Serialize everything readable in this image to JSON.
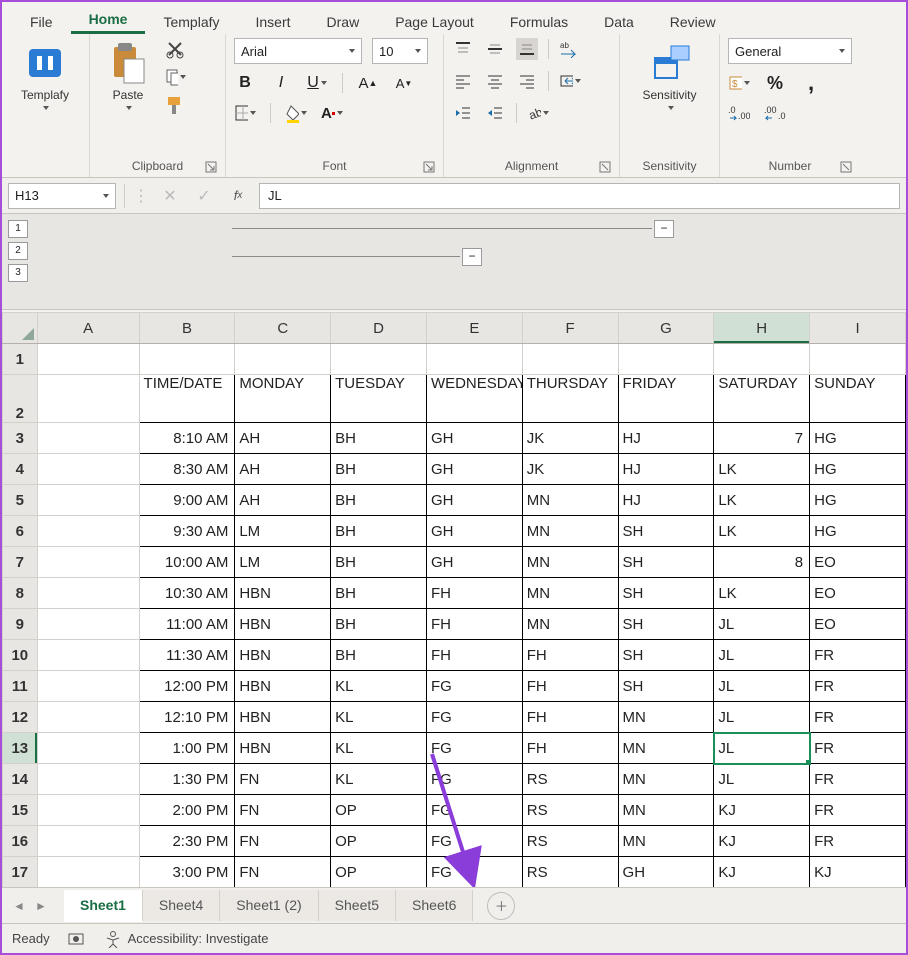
{
  "ribbonTabs": [
    "File",
    "Home",
    "Templafy",
    "Insert",
    "Draw",
    "Page Layout",
    "Formulas",
    "Data",
    "Review"
  ],
  "ribbonActive": 1,
  "groups": {
    "templafy": "Templafy",
    "clipboard": {
      "label": "Clipboard",
      "paste": "Paste"
    },
    "font": {
      "label": "Font",
      "name": "Arial",
      "size": "10"
    },
    "alignment": "Alignment",
    "sensitivity": {
      "label": "Sensitivity",
      "btn": "Sensitivity"
    },
    "number": {
      "label": "Number",
      "format": "General"
    }
  },
  "nameBox": "H13",
  "formula": "JL",
  "outlineButtons": [
    "1",
    "2",
    "3"
  ],
  "columns": [
    "A",
    "B",
    "C",
    "D",
    "E",
    "F",
    "G",
    "H",
    "I"
  ],
  "rowNums": [
    1,
    2,
    3,
    4,
    5,
    6,
    7,
    8,
    9,
    10,
    11,
    12,
    13,
    14,
    15,
    16,
    17
  ],
  "headerRow": [
    "",
    "TIME/DATE",
    "MONDAY",
    "TUESDAY",
    "WEDNESDAY",
    "THURSDAY",
    "FRIDAY",
    "SATURDAY",
    "SUNDAY"
  ],
  "dataRows": [
    [
      "8:10 AM",
      "AH",
      "BH",
      "GH",
      "JK",
      "HJ",
      "7",
      "HG"
    ],
    [
      "8:30 AM",
      "AH",
      "BH",
      "GH",
      "JK",
      "HJ",
      "LK",
      "HG"
    ],
    [
      "9:00 AM",
      "AH",
      "BH",
      "GH",
      "MN",
      "HJ",
      "LK",
      "HG"
    ],
    [
      "9:30 AM",
      "LM",
      "BH",
      "GH",
      "MN",
      "SH",
      "LK",
      "HG"
    ],
    [
      "10:00 AM",
      "LM",
      "BH",
      "GH",
      "MN",
      "SH",
      "8",
      "EO"
    ],
    [
      "10:30 AM",
      "HBN",
      "BH",
      "FH",
      "MN",
      "SH",
      "LK",
      "EO"
    ],
    [
      "11:00 AM",
      "HBN",
      "BH",
      "FH",
      "MN",
      "SH",
      "JL",
      "EO"
    ],
    [
      "11:30 AM",
      "HBN",
      "BH",
      "FH",
      "FH",
      "SH",
      "JL",
      "FR"
    ],
    [
      "12:00 PM",
      "HBN",
      "KL",
      "FG",
      "FH",
      "SH",
      "JL",
      "FR"
    ],
    [
      "12:10 PM",
      "HBN",
      "KL",
      "FG",
      "FH",
      "MN",
      "JL",
      "FR"
    ],
    [
      "1:00 PM",
      "HBN",
      "KL",
      "FG",
      "FH",
      "MN",
      "JL",
      "FR"
    ],
    [
      "1:30 PM",
      "FN",
      "KL",
      "FG",
      "RS",
      "MN",
      "JL",
      "FR"
    ],
    [
      "2:00 PM",
      "FN",
      "OP",
      "FG",
      "RS",
      "MN",
      "KJ",
      "FR"
    ],
    [
      "2:30 PM",
      "FN",
      "OP",
      "FG",
      "RS",
      "MN",
      "KJ",
      "FR"
    ],
    [
      "3:00 PM",
      "FN",
      "OP",
      "FG",
      "RS",
      "GH",
      "KJ",
      "KJ"
    ]
  ],
  "numericHCells": {
    "0": true,
    "4": true
  },
  "activeRow": 13,
  "activeCol": "H",
  "sheets": [
    "Sheet1",
    "Sheet4",
    "Sheet1 (2)",
    "Sheet5",
    "Sheet6"
  ],
  "activeSheet": 0,
  "status": {
    "ready": "Ready",
    "accessibility": "Accessibility: Investigate"
  }
}
